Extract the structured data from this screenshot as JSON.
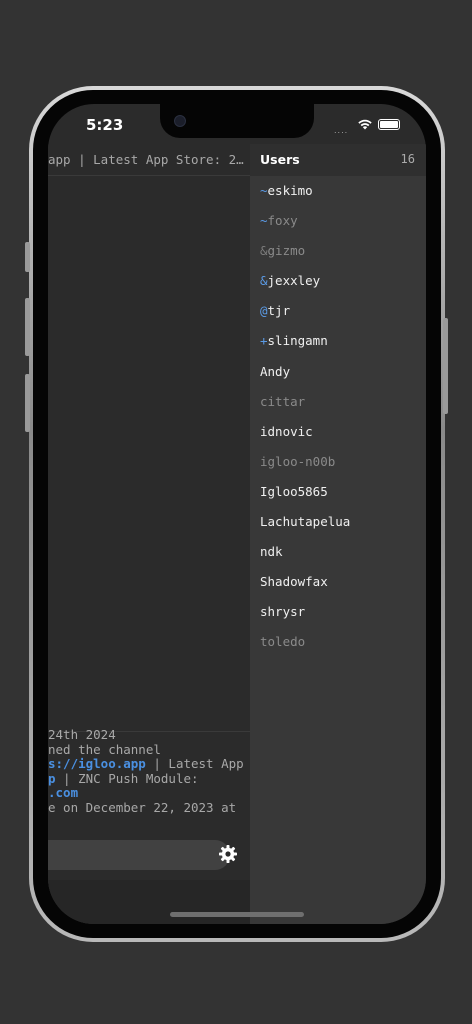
{
  "status": {
    "time": "5:23",
    "signal": "...."
  },
  "chat": {
    "topic": "app | Latest App Store: 2…",
    "messages": {
      "date": " 24th 2024",
      "joined": "ned the channel",
      "topic_link": "s://igloo.app",
      "topic_rest": " | Latest App",
      "line4_a": "p",
      "line4_b": " | ZNC Push Module:",
      "line5_link": ".com",
      "line6": "e on December 22, 2023 at"
    },
    "input": {
      "placeholder": ""
    }
  },
  "users": {
    "title": "Users",
    "count": "16",
    "list": [
      {
        "prefix": "~",
        "nick": "eskimo",
        "state": "active",
        "prefix_color": "#5b9be6"
      },
      {
        "prefix": "~",
        "nick": "foxy",
        "state": "away",
        "prefix_color": "#5b9be6"
      },
      {
        "prefix": "&",
        "nick": "gizmo",
        "state": "away",
        "prefix_color": "#7c7c7c"
      },
      {
        "prefix": "&",
        "nick": "jexxley",
        "state": "active",
        "prefix_color": "#5b9be6"
      },
      {
        "prefix": "@",
        "nick": "tjr",
        "state": "active",
        "prefix_color": "#5b9be6"
      },
      {
        "prefix": "+",
        "nick": "slingamn",
        "state": "active",
        "prefix_color": "#5b9be6"
      },
      {
        "prefix": "",
        "nick": "Andy",
        "state": "active"
      },
      {
        "prefix": "",
        "nick": "cittar",
        "state": "away"
      },
      {
        "prefix": "",
        "nick": "idnovic",
        "state": "active"
      },
      {
        "prefix": "",
        "nick": "igloo-n00b",
        "state": "away"
      },
      {
        "prefix": "",
        "nick": "Igloo5865",
        "state": "active"
      },
      {
        "prefix": "",
        "nick": "Lachutapelua",
        "state": "active"
      },
      {
        "prefix": "",
        "nick": "ndk",
        "state": "active"
      },
      {
        "prefix": "",
        "nick": "Shadowfax",
        "state": "active"
      },
      {
        "prefix": "",
        "nick": "shrysr",
        "state": "active"
      },
      {
        "prefix": "",
        "nick": "toledo",
        "state": "away"
      }
    ]
  },
  "colors": {
    "accent": "#4a90e2",
    "panel": "#383838",
    "background": "#2b2b2b"
  },
  "icons": {
    "settings": "gear-icon",
    "wifi": "wifi-icon",
    "battery": "battery-icon"
  }
}
